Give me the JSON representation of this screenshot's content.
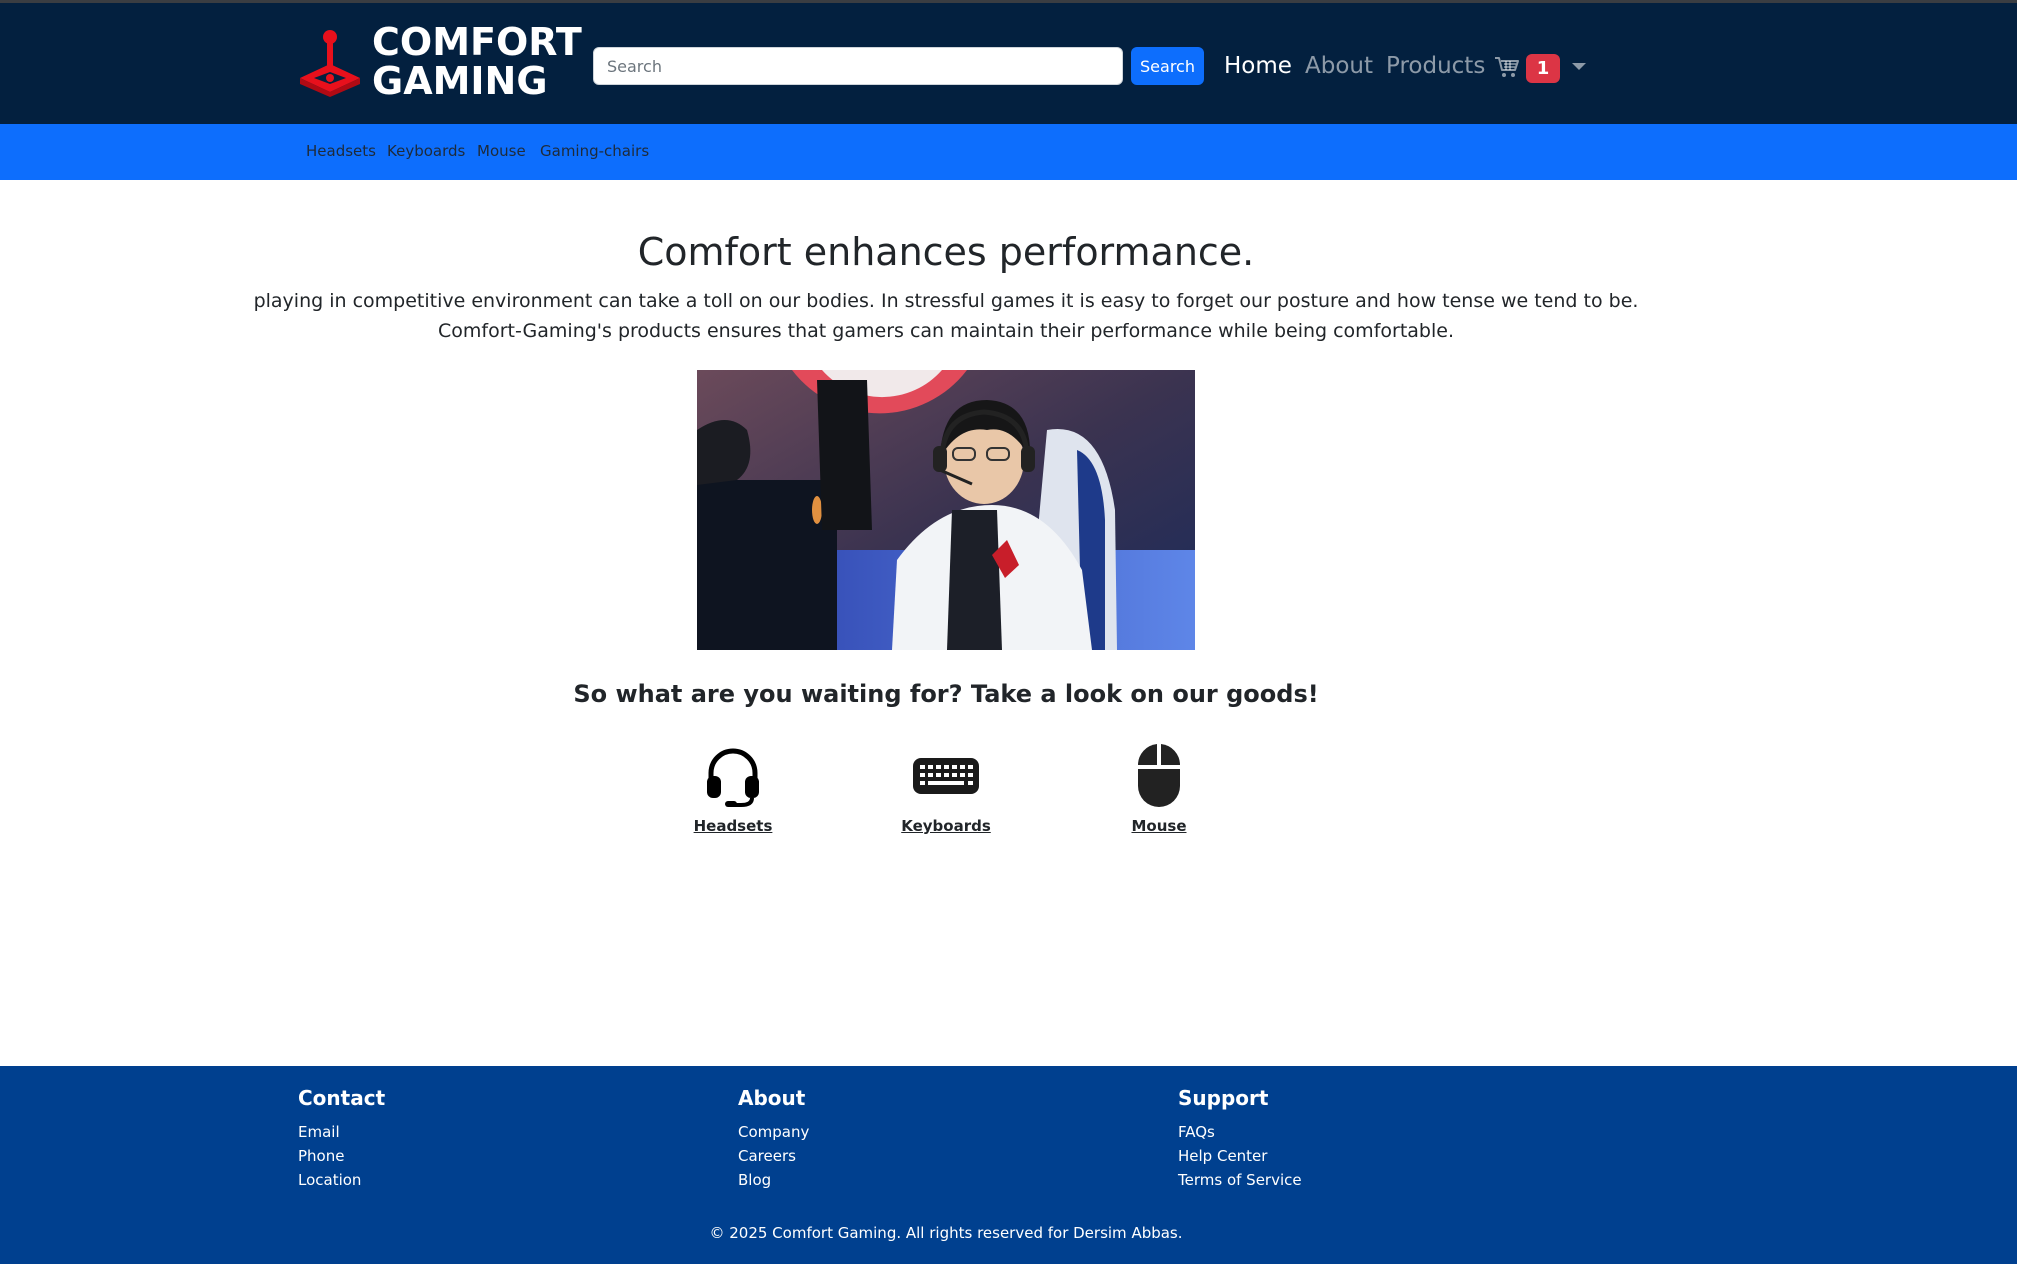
{
  "brand": {
    "name_line1": "COMFORT",
    "name_line2": "GAMING"
  },
  "search": {
    "placeholder": "Search",
    "button_label": "Search"
  },
  "nav": {
    "items": [
      {
        "label": "Home",
        "active": true
      },
      {
        "label": "About",
        "active": false
      },
      {
        "label": "Products",
        "active": false
      }
    ],
    "cart_count": "1"
  },
  "subnav": {
    "items": [
      "Headsets",
      "Keyboards",
      "Mouse",
      "Gaming-chairs"
    ]
  },
  "hero": {
    "headline": "Comfort enhances performance.",
    "paragraph_line1": "playing in competitive environment can take a toll on our bodies. In stressful games it is easy to forget our posture and how tense we tend to be.",
    "paragraph_line2": "Comfort-Gaming's products ensures that gamers can maintain their performance while being comfortable."
  },
  "cta": {
    "text": "So what are you waiting for? Take a look on our goods!"
  },
  "categories": [
    {
      "label": "Headsets",
      "icon": "headset-icon"
    },
    {
      "label": "Keyboards",
      "icon": "keyboard-icon"
    },
    {
      "label": "Mouse",
      "icon": "mouse-icon"
    }
  ],
  "footer": {
    "columns": [
      {
        "heading": "Contact",
        "links": [
          "Email",
          "Phone",
          "Location"
        ]
      },
      {
        "heading": "About",
        "links": [
          "Company",
          "Careers",
          "Blog"
        ]
      },
      {
        "heading": "Support",
        "links": [
          "FAQs",
          "Help Center",
          "Terms of Service"
        ]
      }
    ],
    "copyright": "© 2025 Comfort Gaming. All rights reserved for Dersim Abbas."
  },
  "colors": {
    "navbar_bg": "#03203f",
    "accent_blue": "#0d6efd",
    "badge_red": "#dc3545",
    "footer_bg": "#00408f",
    "logo_red": "#e8101c"
  }
}
